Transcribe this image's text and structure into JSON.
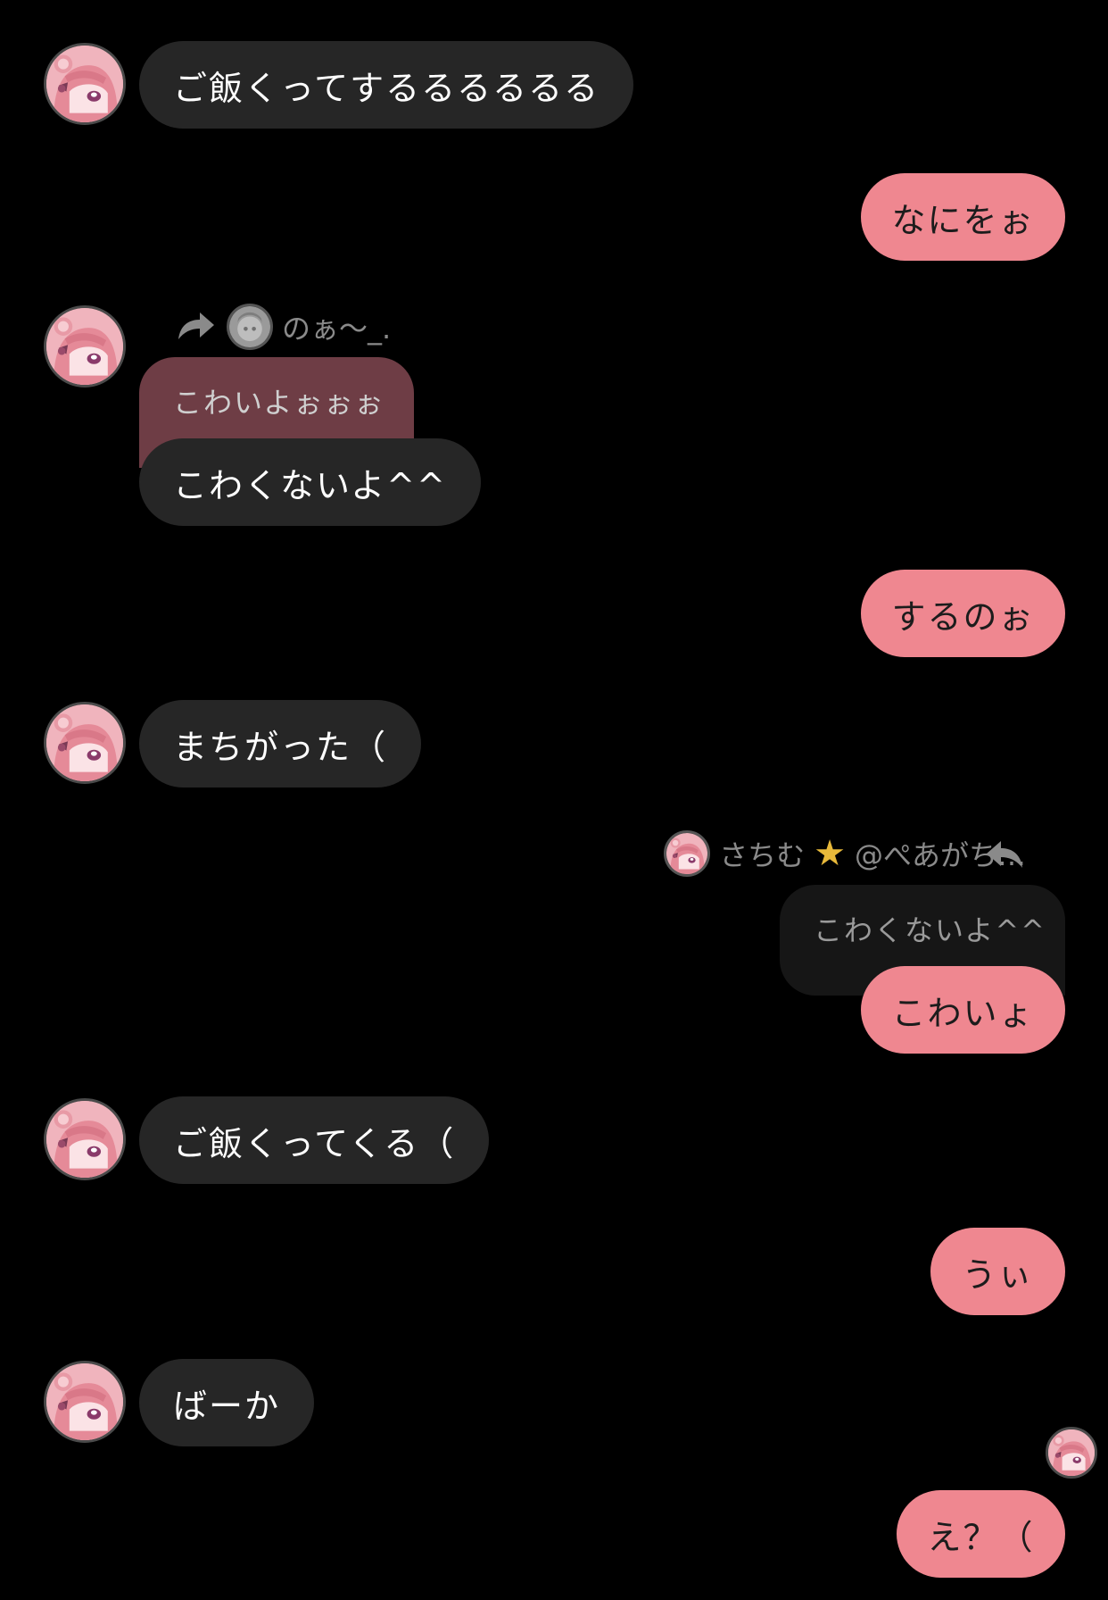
{
  "messages": {
    "m1": "ご飯くってするるるるるる",
    "m2": "なにをぉ",
    "m3_forward_name": "のぁ～_.",
    "m3_quote": "こわいよぉぉぉ",
    "m3": "こわくないよ^^",
    "m4": "するのぉ",
    "m5": "まちがった（",
    "m6_reply_name": "さちむ",
    "m6_reply_handle": "@ぺあがち…",
    "m6_quote": "こわくないよ^^",
    "m6": "こわいょ",
    "m7": "ご飯くってくる（",
    "m8": "うぃ",
    "m9": "ばーか",
    "m10": "え？（"
  },
  "icons": {
    "forward": "forward-arrow-icon",
    "reply": "reply-arrow-icon",
    "star": "star-emoji"
  },
  "colors": {
    "background": "#000000",
    "incoming_bubble": "#262626",
    "outgoing_bubble": "#ef8790",
    "quote_incoming": "#6e3d45",
    "quote_outgoing": "#161616"
  }
}
